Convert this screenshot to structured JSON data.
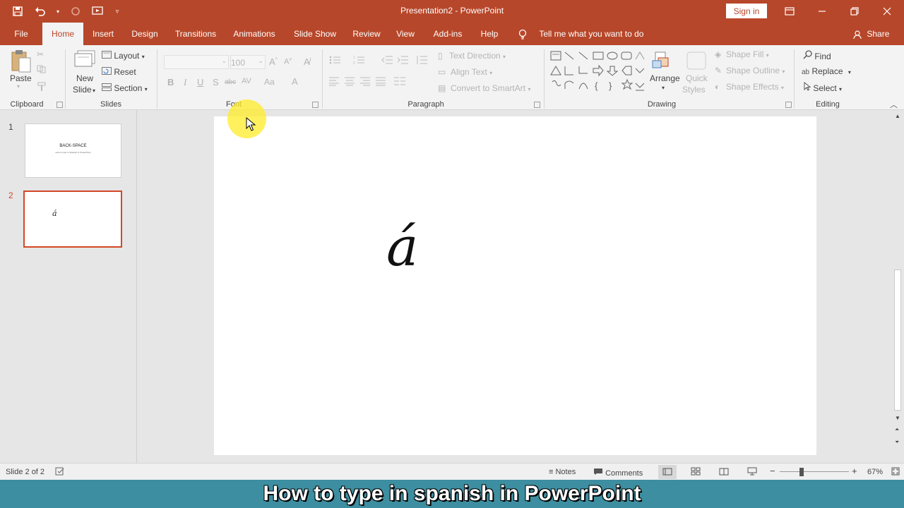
{
  "window": {
    "title": "Presentation2  -  PowerPoint",
    "signin_label": "Sign in"
  },
  "tabs": [
    {
      "label": "File"
    },
    {
      "label": "Home"
    },
    {
      "label": "Insert"
    },
    {
      "label": "Design"
    },
    {
      "label": "Transitions"
    },
    {
      "label": "Animations"
    },
    {
      "label": "Slide Show"
    },
    {
      "label": "Review"
    },
    {
      "label": "View"
    },
    {
      "label": "Add-ins"
    },
    {
      "label": "Help"
    }
  ],
  "tellme_label": "Tell me what you want to do",
  "share_label": "Share",
  "ribbon": {
    "clipboard": {
      "label": "Clipboard",
      "paste": "Paste"
    },
    "slides": {
      "label": "Slides",
      "new_slide": "New",
      "new_slide2": "Slide",
      "layout": "Layout",
      "reset": "Reset",
      "section": "Section"
    },
    "font": {
      "label": "Font",
      "size": "100"
    },
    "paragraph": {
      "label": "Paragraph",
      "text_direction": "Text Direction",
      "align_text": "Align Text",
      "convert_smartart": "Convert to SmartArt"
    },
    "drawing": {
      "label": "Drawing",
      "arrange": "Arrange",
      "quick_styles": "Quick",
      "quick_styles2": "Styles",
      "shape_fill": "Shape Fill",
      "shape_outline": "Shape Outline",
      "shape_effects": "Shape Effects"
    },
    "editing": {
      "label": "Editing",
      "find": "Find",
      "replace": "Replace",
      "select": "Select"
    }
  },
  "thumbnails": [
    {
      "number": "1",
      "title": "BACK-SPACE",
      "subtitle": "How to type in Spanish in PowerPoint"
    },
    {
      "number": "2",
      "content": "á"
    }
  ],
  "slide": {
    "content": "á"
  },
  "status": {
    "slide_info": "Slide 2 of 2",
    "notes": "Notes",
    "comments": "Comments",
    "zoom": "67%"
  },
  "caption": "How to type in spanish in PowerPoint",
  "colors": {
    "accent": "#b7472a",
    "caption_bg": "#3d8ea0",
    "selection": "#d24726"
  }
}
